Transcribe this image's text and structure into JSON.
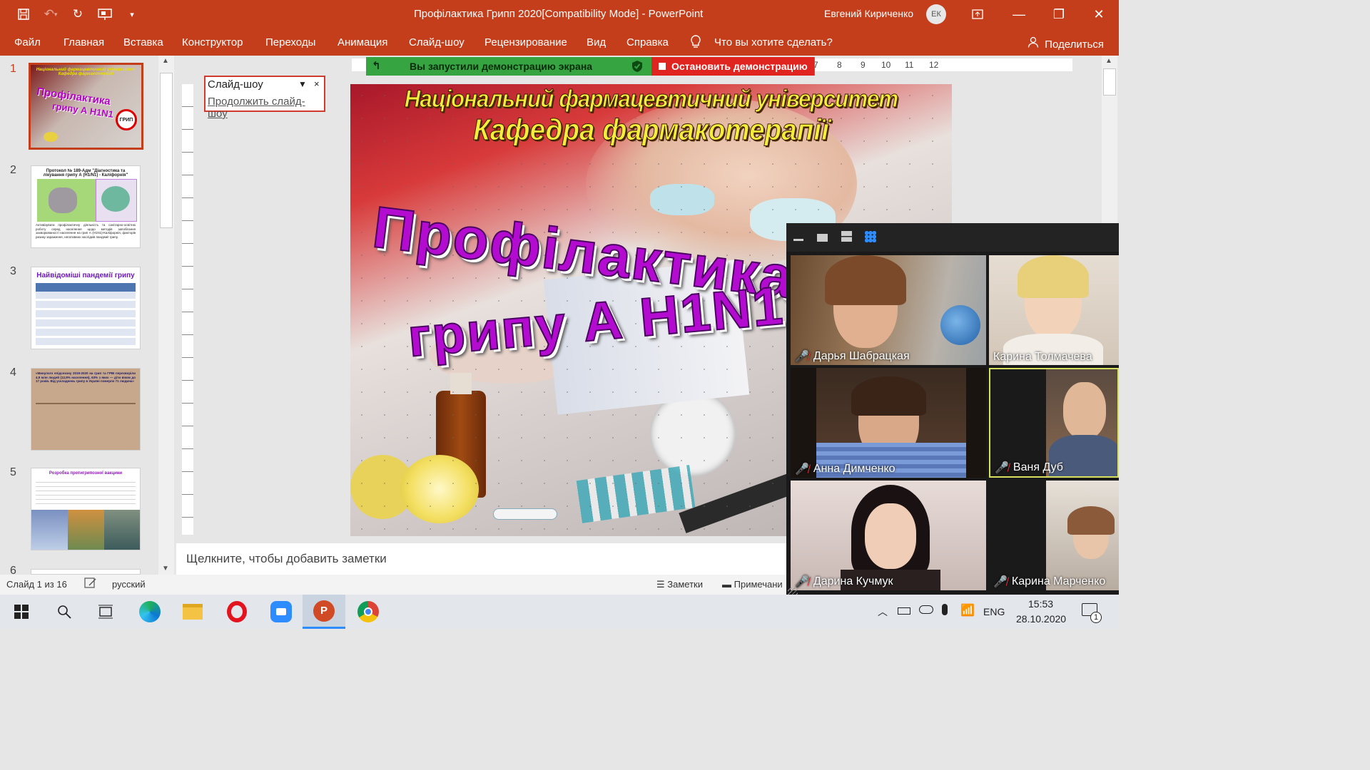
{
  "window": {
    "title": "Профілактика Грипп 2020[Compatibility Mode]  -  PowerPoint",
    "user_name": "Евгений Кириченко",
    "user_initials": "ЕК"
  },
  "ribbon_tabs": [
    "Файл",
    "Главная",
    "Вставка",
    "Конструктор",
    "Переходы",
    "Анимация",
    "Слайд-шоу",
    "Рецензирование",
    "Вид",
    "Справка"
  ],
  "tell_me": "Что вы хотите сделать?",
  "share_label": "Поделиться",
  "thumbnails": {
    "numbers": [
      "1",
      "2",
      "3",
      "4",
      "5",
      "6"
    ],
    "slide2_title": "Протокол № 189-Адм \"Діагностика та лікування грипу А (H1/N1) - Каліфорнія\"",
    "slide2_text": "Активізувати профілактичну діяльність та санітарно-освітню роботу серед населення щодо методів запобігання захворюваності населення на грип А (H1N1)-Каліфорнія, факторів ризику зараження, негативних наслідків пандемії грипу.",
    "slide3_title": "Найвідоміші пандемії грипу",
    "slide4_text": "«Минулого епідсезону 2019-2020 на грип та ГРВІ перехворіли 4,9 млн людей (12,9% населення), 63% з яких — діти віком до 17 років. Від ускладнень грипу в Україні померло 71 людина»",
    "slide5_title": "Розробка протигрипозної вакцини"
  },
  "screen_share": {
    "banner": "Вы запустили демонстрацию экрана",
    "stop": "Остановить демонстрацию"
  },
  "slideshow_box": {
    "title": "Слайд-шоу",
    "link": "Продолжить слайд-шоу"
  },
  "ruler_numbers": [
    "7",
    "8",
    "9",
    "10",
    "11",
    "12"
  ],
  "slide": {
    "line1": "Національний фармацевтичний університет",
    "line2": "Кафедра фармакотерапії",
    "title1": "Профілактика",
    "title2": "грипу А H1N1"
  },
  "notes_placeholder": "Щелкните, чтобы добавить заметки",
  "status": {
    "slide_count": "Слайд 1 из 16",
    "language": "русский",
    "notes": "Заметки",
    "comments": "Примечани"
  },
  "participants": [
    {
      "name": "Дарья Шабрацкая",
      "muted": true
    },
    {
      "name": "Карина Толмачева",
      "muted": false
    },
    {
      "name": "Анна Димченко",
      "muted": true
    },
    {
      "name": "Ваня Дуб",
      "muted": true
    },
    {
      "name": "Дарина Кучмук",
      "muted": true
    },
    {
      "name": "Карина Марченко",
      "muted": true
    }
  ],
  "taskbar": {
    "time": "15:53",
    "date": "28.10.2020",
    "language": "ENG",
    "notification_count": "1"
  }
}
